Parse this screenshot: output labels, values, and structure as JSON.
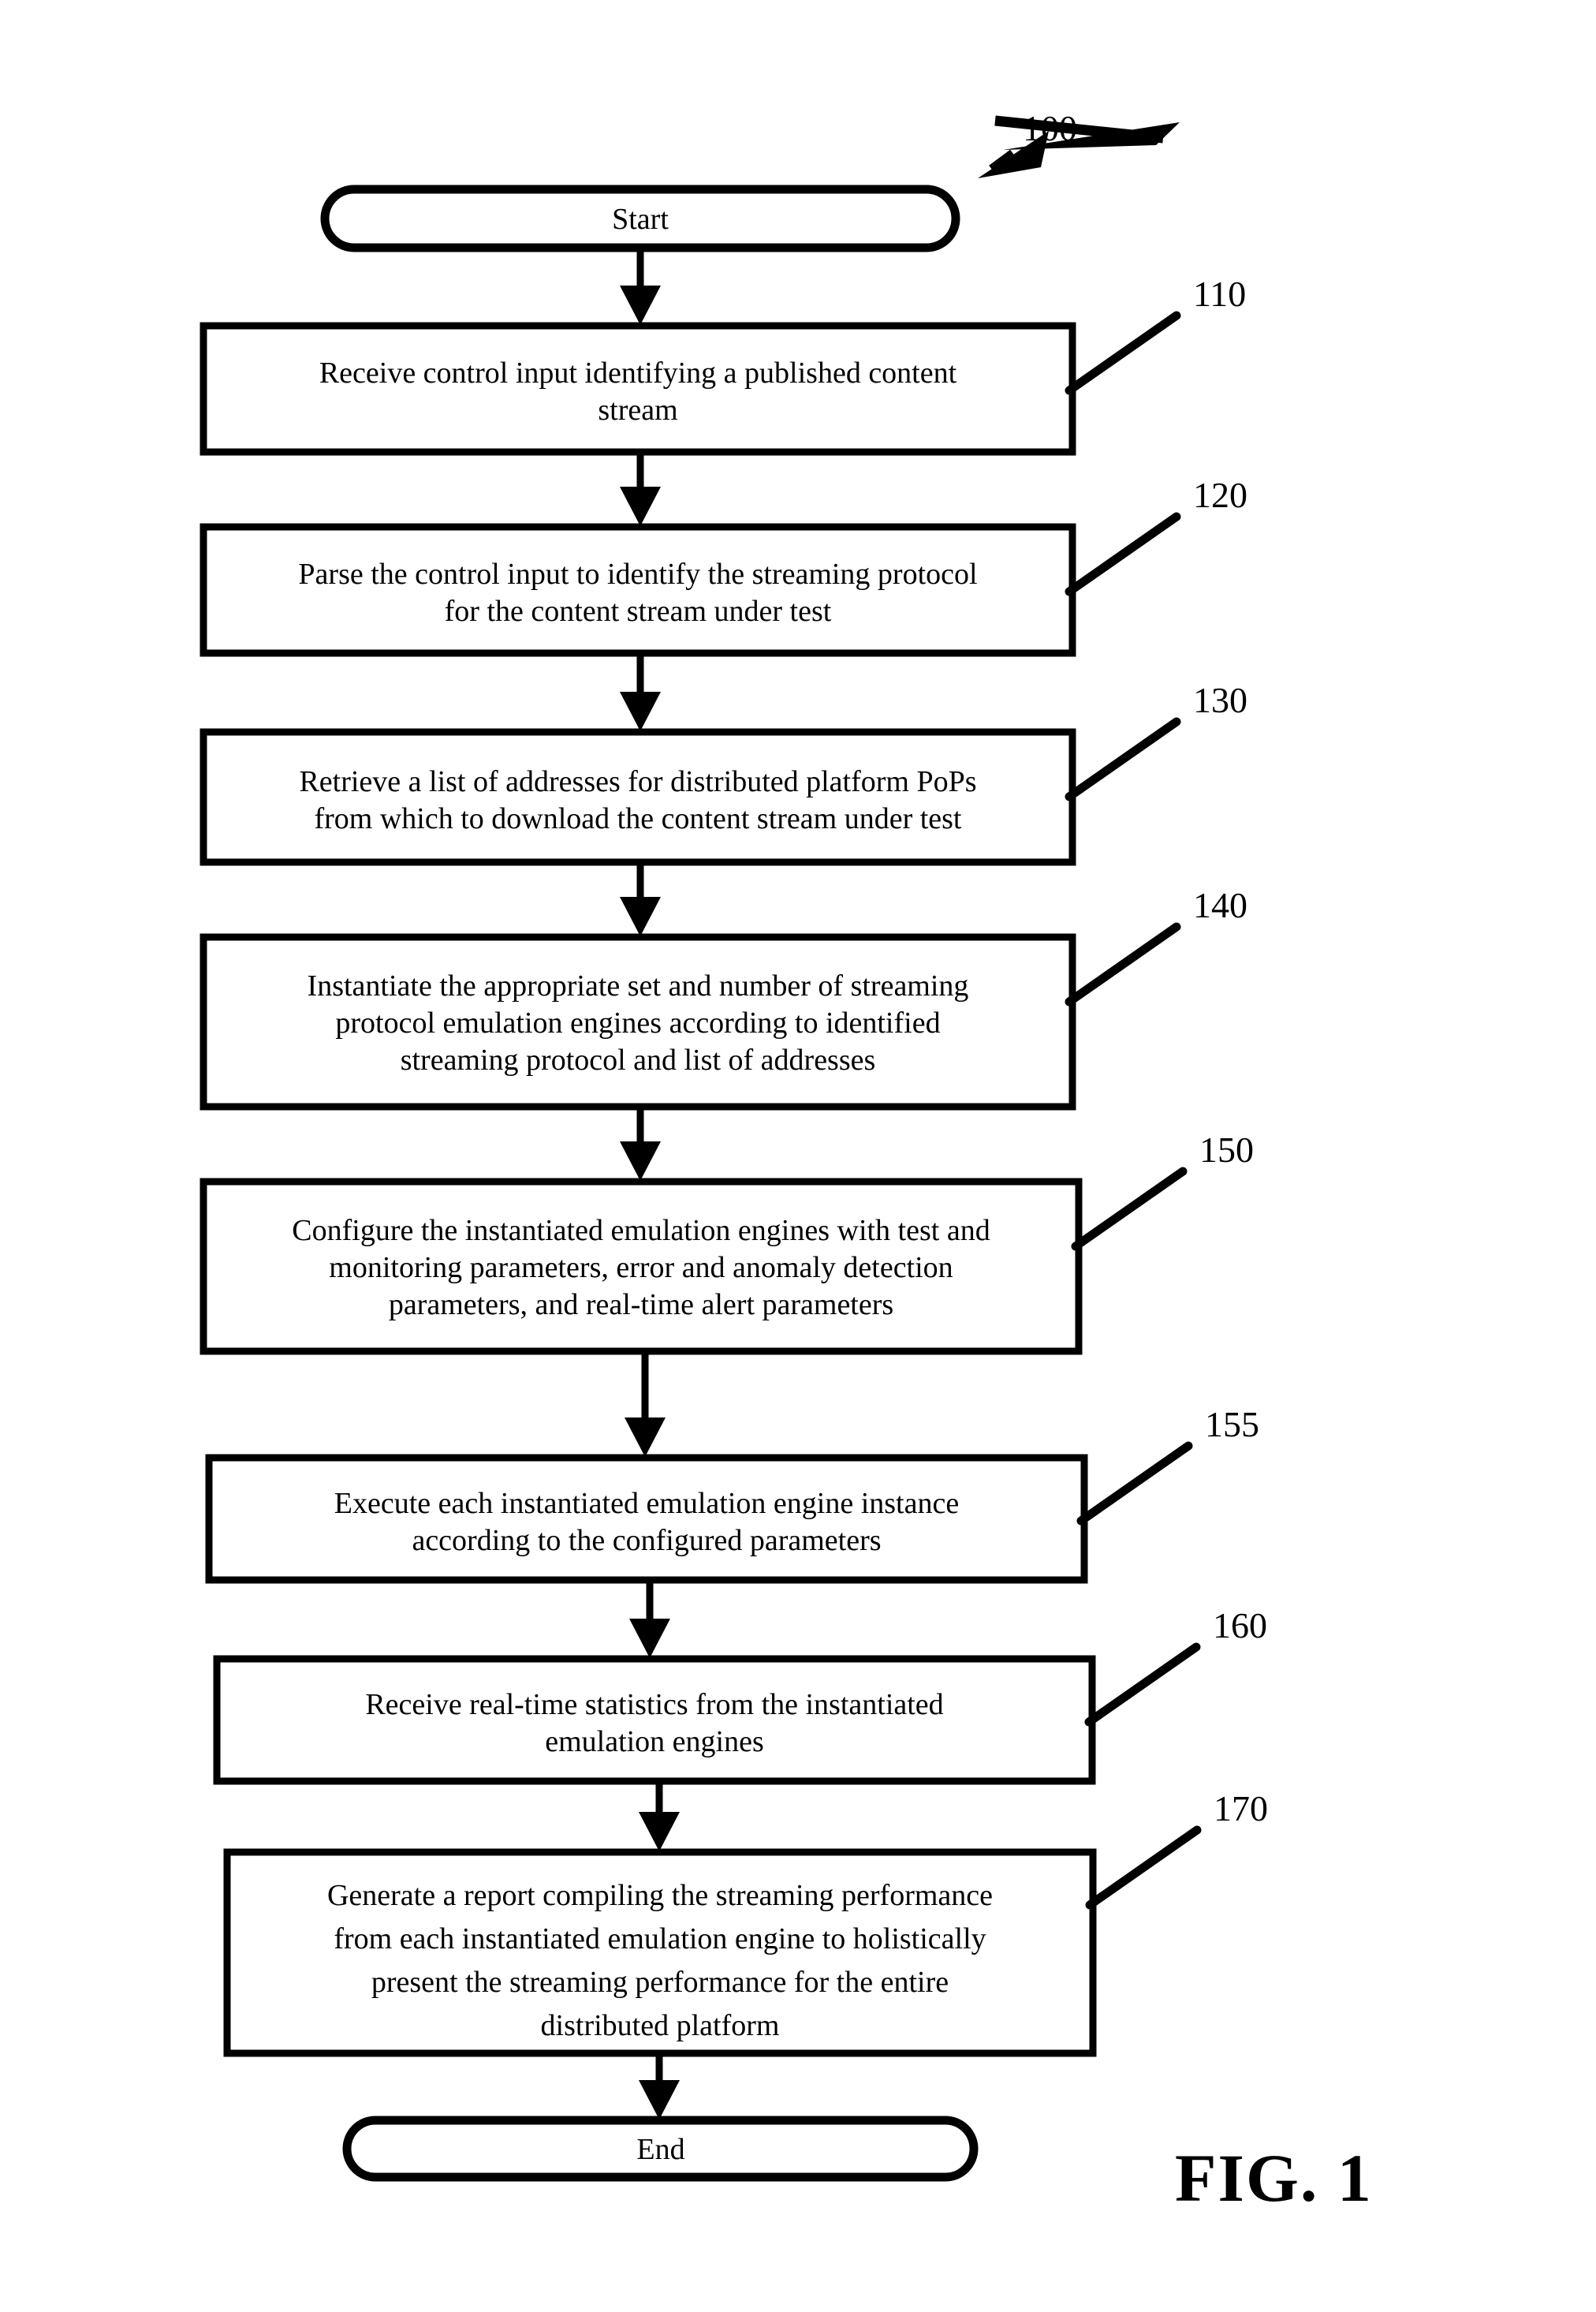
{
  "figure": {
    "caption": "FIG. 1",
    "process_ref": "100",
    "terminators": {
      "start": "Start",
      "end": "End"
    },
    "steps": [
      {
        "ref": "110",
        "lines": [
          "Receive control input identifying a published content",
          "stream"
        ]
      },
      {
        "ref": "120",
        "lines": [
          "Parse the control input to identify the streaming protocol",
          "for the content stream under test"
        ]
      },
      {
        "ref": "130",
        "lines": [
          "Retrieve a list of addresses for distributed platform PoPs",
          "from which to download the content stream under test"
        ]
      },
      {
        "ref": "140",
        "lines": [
          "Instantiate the appropriate set and number of streaming",
          "protocol emulation engines according to identified",
          "streaming protocol and list of addresses"
        ]
      },
      {
        "ref": "150",
        "lines": [
          "Configure the instantiated emulation engines with test and",
          "monitoring parameters, error and anomaly detection",
          "parameters, and real-time alert parameters"
        ]
      },
      {
        "ref": "155",
        "lines": [
          "Execute each instantiated emulation engine instance",
          "according to the configured parameters"
        ]
      },
      {
        "ref": "160",
        "lines": [
          "Receive real-time statistics from the instantiated",
          "emulation engines"
        ]
      },
      {
        "ref": "170",
        "lines": [
          "Generate a report compiling the streaming performance",
          "from each instantiated emulation engine to holistically",
          "present the streaming performance for the entire",
          "distributed platform"
        ]
      }
    ],
    "colors": {
      "stroke": "#000000",
      "fill": "#ffffff",
      "background": "#ffffff"
    }
  }
}
